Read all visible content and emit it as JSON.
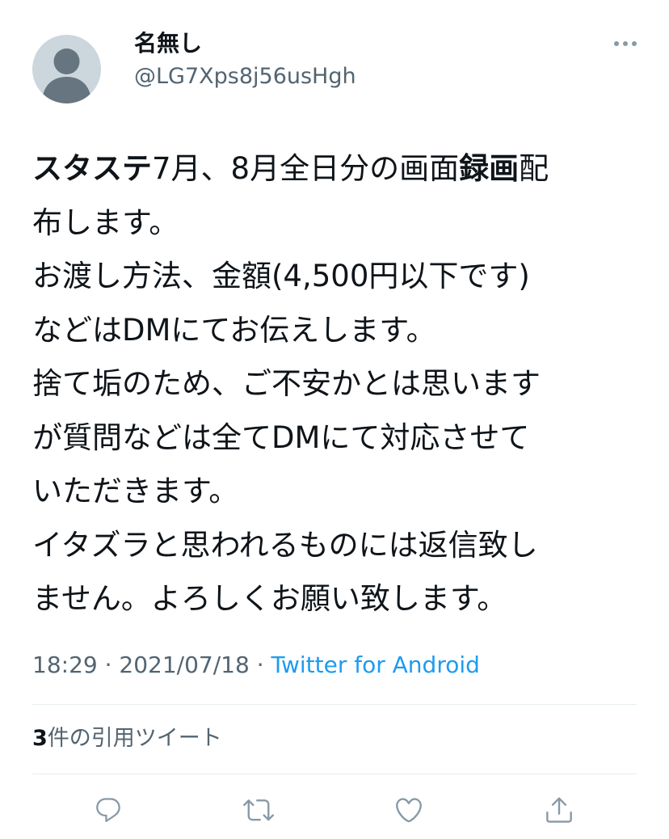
{
  "user": {
    "display_name": "名無し",
    "handle": "@LG7Xps8j56usHgh",
    "avatar_icon": "default-avatar-icon"
  },
  "tweet": {
    "lines": [
      [
        {
          "text": "スタステ",
          "bold": true
        },
        {
          "text": "7月、8月全日分の画面"
        },
        {
          "text": "録画",
          "bold": true
        },
        {
          "text": "配"
        }
      ],
      [
        {
          "text": "布します。"
        }
      ],
      [
        {
          "text": "お渡し方法、金額(4,500円以下です)"
        }
      ],
      [
        {
          "text": "などはDMにてお伝えします。"
        }
      ],
      [
        {
          "text": "捨て垢のため、ご不安かとは思います"
        }
      ],
      [
        {
          "text": "が質問などは全てDMにて対応させて"
        }
      ],
      [
        {
          "text": "いただきます。"
        }
      ],
      [
        {
          "text": "イタズラと思われるものには返信致し"
        }
      ],
      [
        {
          "text": "ません。よろしくお願い致します。"
        }
      ]
    ]
  },
  "meta": {
    "time": "18:29",
    "separator": " · ",
    "date": "2021/07/18",
    "source": "Twitter for Android"
  },
  "quotes": {
    "count": "3",
    "label": "件の引用ツイート"
  },
  "actions": [
    {
      "name": "reply",
      "icon": "reply-icon"
    },
    {
      "name": "retweet",
      "icon": "retweet-icon"
    },
    {
      "name": "like",
      "icon": "heart-icon"
    },
    {
      "name": "share",
      "icon": "share-icon"
    }
  ],
  "colors": {
    "text": "#0f1419",
    "secondary": "#536471",
    "link": "#1d9bf0",
    "divider": "#e6ecf0",
    "avatar_bg": "#ccd6dd",
    "avatar_fg": "#66757f",
    "icon": "#8899a6"
  }
}
